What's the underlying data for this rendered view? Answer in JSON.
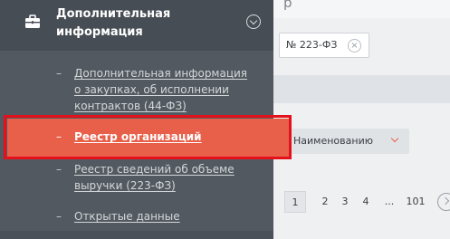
{
  "sidebar": {
    "header": {
      "title_line1": "Дополнительная",
      "title_line2": "информация"
    },
    "items": [
      {
        "dash": "–",
        "line1": "Дополнительная информация",
        "line2": "о закупках, об исполнении",
        "line3": "контрактов (44-ФЗ)"
      },
      {
        "dash": "–",
        "label": "Реестр организаций",
        "active": true
      },
      {
        "dash": "–",
        "line1": "Реестр сведений об объеме",
        "line2": "выручки (223-ФЗ)"
      },
      {
        "dash": "–",
        "label": "Открытые данные"
      }
    ]
  },
  "content": {
    "top_glyph": "р",
    "filter_tag": {
      "label": "№ 223-ФЗ",
      "remove": "×"
    },
    "sort": {
      "selected": "Наименованию"
    },
    "pagination": {
      "current": "1",
      "pages": [
        "2",
        "3",
        "4"
      ],
      "ellipsis": "...",
      "last": "101"
    }
  },
  "colors": {
    "sidebar_bg": "#525960",
    "active_bg": "#e8604a",
    "highlight_outline": "#e4111c"
  }
}
